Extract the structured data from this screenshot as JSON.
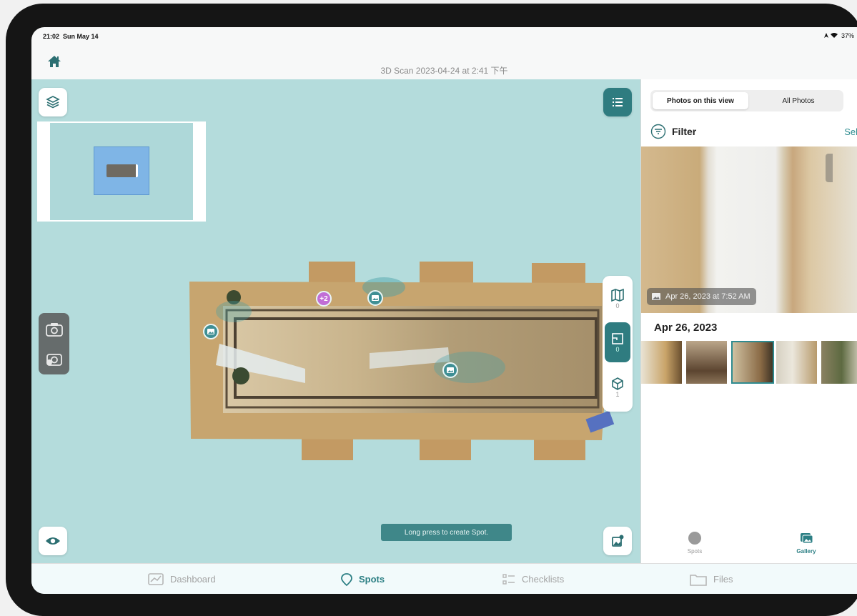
{
  "status": {
    "time": "21:02",
    "date": "Sun May 14",
    "battery": "37%"
  },
  "header": {
    "title": "3D Scan 2023-04-24 at 2:41 下午",
    "home_icon": "home-icon"
  },
  "map": {
    "background": "#b4dcdc",
    "layers_icon": "layers-icon",
    "list_icon": "list-icon",
    "camera_icon": "camera-icon",
    "camera_spot_icon": "camera-plus-icon",
    "eye_icon": "eye-icon",
    "image_edit_icon": "image-edit-icon",
    "cluster_label": "+2",
    "toast": "Long press to create Spot.",
    "tools": [
      {
        "icon": "map-icon",
        "count": "0"
      },
      {
        "icon": "floorplan-icon",
        "count": "0"
      },
      {
        "icon": "cube-icon",
        "count": "1"
      }
    ]
  },
  "panel": {
    "tabs": {
      "active": "Photos on this view",
      "inactive": "All Photos"
    },
    "filter": "Filter",
    "select": "Sel",
    "photo_caption": "Apr 26, 2023 at 7:52 AM",
    "date_header": "Apr 26, 2023",
    "bottom_tabs": [
      "Spots",
      "Gallery"
    ]
  },
  "nav": {
    "items": [
      "Dashboard",
      "Spots",
      "Checklists",
      "Files"
    ],
    "active": "Spots",
    "accent": "#2c7f84"
  }
}
